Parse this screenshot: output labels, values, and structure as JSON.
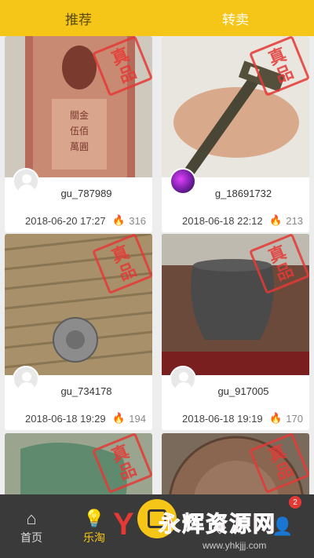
{
  "tabs": [
    {
      "label": "推荐",
      "active": true
    },
    {
      "label": "转卖",
      "active": false
    }
  ],
  "stamp_text": "真品",
  "cards": [
    {
      "username": "gu_787989",
      "datetime": "2018-06-20 17:27",
      "heat": "316",
      "image": "red-banknote",
      "avatar": "default"
    },
    {
      "username": "g_18691732",
      "datetime": "2018-06-18 22:12",
      "heat": "213",
      "image": "bronze-blade-in-hand",
      "avatar": "purple-photo"
    },
    {
      "username": "gu_734178",
      "datetime": "2018-06-18 19:29",
      "heat": "194",
      "image": "coin-on-mat",
      "avatar": "default"
    },
    {
      "username": "gu_917005",
      "datetime": "2018-06-18 19:19",
      "heat": "170",
      "image": "dark-pottery-jar",
      "avatar": "default"
    },
    {
      "image": "jade-green-piece"
    },
    {
      "image": "copper-coin-closeup"
    }
  ],
  "bottom_nav": [
    {
      "label": "首页",
      "icon": "home-icon",
      "active": false
    },
    {
      "label": "乐淘",
      "icon": "bulb-icon",
      "active": true
    },
    {
      "label": "",
      "icon": "center-publish-icon",
      "active": false
    },
    {
      "label": "",
      "icon": "compass-icon",
      "active": false
    },
    {
      "label": "",
      "icon": "user-icon",
      "active": false,
      "badge": "2"
    }
  ],
  "watermark": {
    "brand": "永辉资源网",
    "url": "www.yhkjjj.com"
  },
  "colors": {
    "accent": "#f5c518",
    "nav_bg": "#3a3a3a",
    "stamp": "#e53935"
  }
}
